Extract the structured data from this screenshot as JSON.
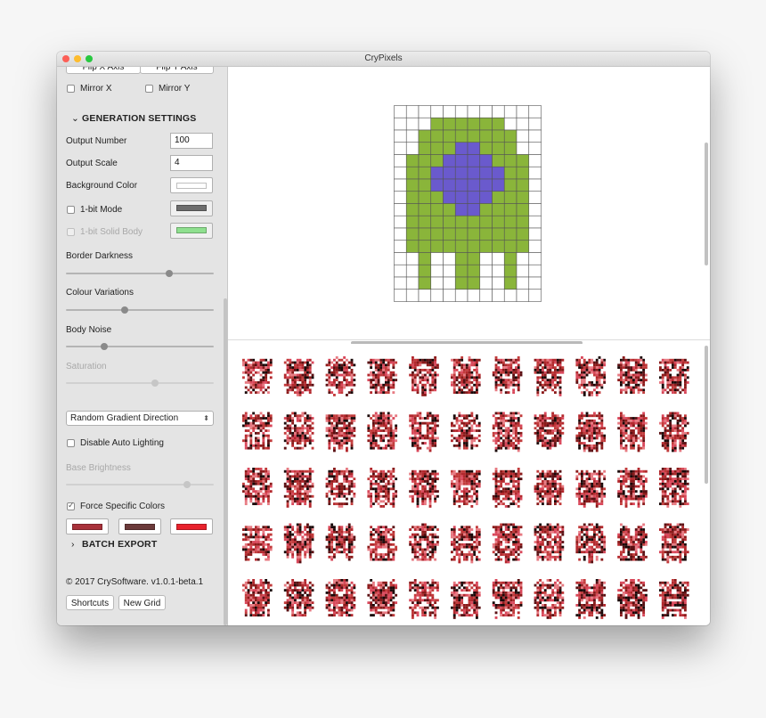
{
  "window": {
    "title": "CryPixels"
  },
  "sidebar": {
    "flip_x_label": "Flip X Axis",
    "flip_y_label": "Flip Y Axis",
    "mirror_x_label": "Mirror X",
    "mirror_y_label": "Mirror Y",
    "generation_settings_title": "GENERATION SETTINGS",
    "output_number_label": "Output Number",
    "output_number_value": "100",
    "output_scale_label": "Output Scale",
    "output_scale_value": "4",
    "background_color_label": "Background Color",
    "background_color": "#ffffff",
    "one_bit_mode_label": "1-bit Mode",
    "one_bit_mode_color": "#6e6e6e",
    "one_bit_solid_body_label": "1-bit Solid Body",
    "one_bit_solid_body_color": "#8fe08f",
    "border_darkness_label": "Border Darkness",
    "border_darkness_value": 0.7,
    "colour_variations_label": "Colour Variations",
    "colour_variations_value": 0.4,
    "body_noise_label": "Body Noise",
    "body_noise_value": 0.26,
    "saturation_label": "Saturation",
    "saturation_value": 0.6,
    "gradient_direction_selected": "Random Gradient Direction",
    "disable_auto_lighting_label": "Disable Auto Lighting",
    "base_brightness_label": "Base Brightness",
    "base_brightness_value": 0.82,
    "force_specific_colors_label": "Force Specific Colors",
    "force_colors": [
      "#a8313a",
      "#6b3a3a",
      "#e8222c"
    ],
    "batch_export_title": "BATCH EXPORT",
    "copyright": "© 2017 CrySoftware. v1.0.1-beta.1",
    "shortcuts_label": "Shortcuts",
    "new_grid_label": "New Grid"
  },
  "editor": {
    "grid_cols": 12,
    "grid_rows": 16,
    "body_color": "#8ab53a",
    "core_color": "#6a5acd",
    "rows": [
      "............",
      "...######...",
      "..########..",
      "..###OO###..",
      ".###OOOO###.",
      ".##OOOOOO##.",
      ".##OOOOOO##.",
      ".###OOOO###.",
      ".####OO####.",
      ".##########.",
      ".##########.",
      ".##########.",
      "..#..##..#..",
      "..#..##..#..",
      "..#..##..#..",
      "............"
    ]
  },
  "output": {
    "rows": 5,
    "cols": 11,
    "palette": [
      "#8b1a1a",
      "#b3282d",
      "#d9475a",
      "#e77a82",
      "#5a0f12",
      "#1a0808",
      "#c23b3b"
    ]
  }
}
